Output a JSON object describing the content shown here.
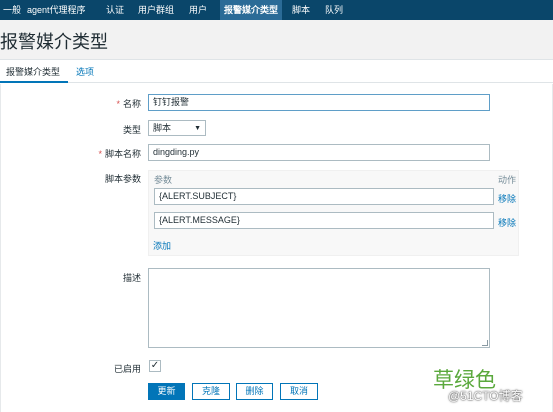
{
  "nav": {
    "items": [
      "一般",
      "agent代理程序",
      "认证",
      "用户群组",
      "用户",
      "报警媒介类型",
      "脚本",
      "队列"
    ],
    "active_index": 5
  },
  "page": {
    "title": "报警媒介类型"
  },
  "tabs": [
    {
      "label": "报警媒介类型",
      "active": true
    },
    {
      "label": "选项",
      "active": false
    }
  ],
  "form": {
    "name": {
      "label": "名称",
      "value": "钉钉报警",
      "required": true
    },
    "type": {
      "label": "类型",
      "value": "脚本"
    },
    "script_name": {
      "label": "脚本名称",
      "value": "dingding.py",
      "required": true
    },
    "script_params": {
      "label": "脚本参数",
      "column_param": "参数",
      "column_action": "动作",
      "rows": [
        {
          "value": "{ALERT.SUBJECT}",
          "action": "移除"
        },
        {
          "value": "{ALERT.MESSAGE}",
          "action": "移除"
        }
      ],
      "add_label": "添加"
    },
    "description": {
      "label": "描述",
      "value": ""
    },
    "enabled": {
      "label": "已启用",
      "checked": true,
      "check_glyph": "✓"
    }
  },
  "buttons": {
    "update": "更新",
    "clone": "克隆",
    "delete": "删除",
    "cancel": "取消"
  },
  "watermark": {
    "green_text": "草绿色",
    "site_text": "@51CTO博客",
    "green_color": "#5aa83c"
  },
  "colors": {
    "nav_bg": "#0a466a",
    "nav_active": "#2b6b97",
    "link": "#0275b8",
    "required": "#d64e4e"
  }
}
